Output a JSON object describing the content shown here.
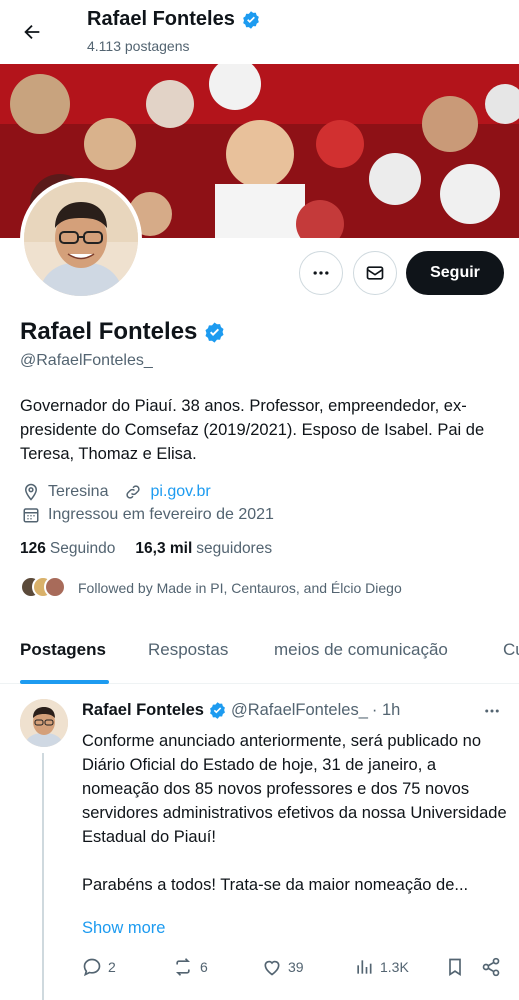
{
  "header": {
    "name": "Rafael Fonteles",
    "post_count": "4.113 postagens"
  },
  "profile": {
    "name": "Rafael Fonteles",
    "handle": "@RafaelFonteles_",
    "bio": "Governador do Piauí. 38 anos. Professor, empreendedor, ex-presidente do Comsefaz (2019/2021). Esposo de Isabel. Pai de Teresa, Thomaz e Elisa.",
    "location": "Teresina",
    "website": "pi.gov.br",
    "joined": "Ingressou em fevereiro de 2021",
    "following_count": "126",
    "following_label": "Seguindo",
    "followers_count": "16,3 mil",
    "followers_label": "seguidores",
    "followed_by": "Followed by Made in PI, Centauros, and Élcio Diego",
    "follow_button": "Seguir"
  },
  "tabs": [
    {
      "label": "Postagens",
      "active": true
    },
    {
      "label": "Respostas",
      "active": false
    },
    {
      "label": "meios de comunicação",
      "active": false
    },
    {
      "label": "Cu",
      "active": false
    }
  ],
  "post": {
    "author": "Rafael Fonteles",
    "handle": "@RafaelFonteles_",
    "time": "· 1h",
    "text": "Conforme anunciado anteriormente, será publicado no Diário Oficial do Estado de hoje, 31 de janeiro, a nomeação dos 85 novos professores e dos 75 novos servidores administrativos efetivos da nossa Universidade Estadual do Piauí!\n\nParabéns a todos! Trata-se da maior nomeação de...",
    "show_more": "Show more",
    "replies": "2",
    "reposts": "6",
    "likes": "39",
    "views": "1.3K"
  },
  "colors": {
    "verified": "#1d9bf0",
    "accent": "#1d9bf0",
    "banner": "#b3141b"
  },
  "icons": [
    "back-arrow-icon",
    "verified-badge-icon",
    "more-icon",
    "mail-icon",
    "location-icon",
    "link-icon",
    "calendar-icon",
    "reply-icon",
    "repost-icon",
    "like-icon",
    "views-icon",
    "bookmark-icon",
    "share-icon"
  ]
}
